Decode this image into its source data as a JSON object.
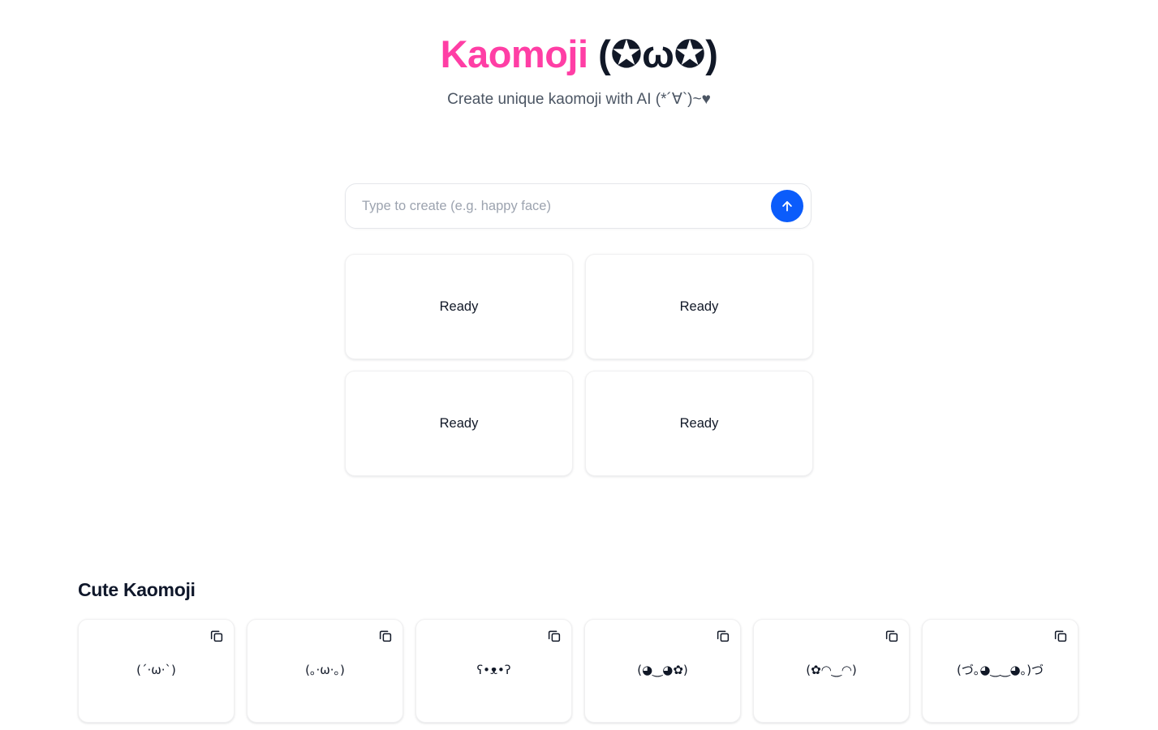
{
  "header": {
    "title_brand": "Kaomoji",
    "title_face": "(✪ω✪)",
    "subtitle": "Create unique kaomoji with AI (*´∀`)~♥",
    "brand_color": "#FF3EA5",
    "face_color": "#111827"
  },
  "search": {
    "placeholder": "Type to create (e.g. happy face)",
    "value": "",
    "submit_icon": "arrow-up-icon",
    "submit_color": "#0B5CFB"
  },
  "results": {
    "cards": [
      {
        "status": "Ready"
      },
      {
        "status": "Ready"
      },
      {
        "status": "Ready"
      },
      {
        "status": "Ready"
      }
    ]
  },
  "gallery": {
    "title": "Cute Kaomoji",
    "copy_icon": "copy-icon",
    "items": [
      {
        "kaomoji": "(´·ω·`)"
      },
      {
        "kaomoji": "(｡·ω·｡)"
      },
      {
        "kaomoji": "ʕ•ᴥ•ʔ"
      },
      {
        "kaomoji": "(◕‿◕✿)"
      },
      {
        "kaomoji": "(✿◠‿◠)"
      },
      {
        "kaomoji": "(づ｡◕‿‿◕｡)づ"
      }
    ]
  }
}
